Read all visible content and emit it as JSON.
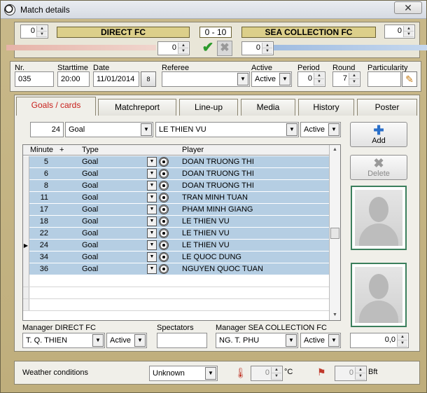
{
  "window": {
    "title": "Match details",
    "close_glyph": "✕"
  },
  "match": {
    "home_team": "DIRECT FC",
    "away_team": "SEA COLLECTION FC",
    "score": "0  - 10",
    "home_left_value": "0",
    "away_right_value": "0",
    "home_sub_value": "0",
    "away_sub_value": "0"
  },
  "details": {
    "nr_label": "Nr.",
    "nr_value": "035",
    "starttime_label": "Starttime",
    "starttime_value": "20:00",
    "date_label": "Date",
    "date_value": "11/01/2014",
    "calendar_glyph": "8",
    "referee_label": "Referee",
    "referee_value": "",
    "active_label": "Active",
    "active_value": "Active",
    "period_label": "Period",
    "period_value": "0",
    "round_label": "Round",
    "round_value": "7",
    "particularity_label": "Particularity",
    "particularity_value": ""
  },
  "tabs": [
    {
      "label": "Goals / cards",
      "active": true
    },
    {
      "label": "Matchreport",
      "active": false
    },
    {
      "label": "Line-up",
      "active": false
    },
    {
      "label": "Media",
      "active": false
    },
    {
      "label": "History",
      "active": false
    },
    {
      "label": "Poster",
      "active": false
    }
  ],
  "entry": {
    "minute": "24",
    "type": "Goal",
    "player": "LE THIEN VU",
    "status": "Active"
  },
  "grid": {
    "headers": {
      "minute": "Minute",
      "plus": "+",
      "type": "Type",
      "player": "Player"
    },
    "rows": [
      {
        "minute": "5",
        "type": "Goal",
        "player": "DOAN TRUONG THI",
        "current": false
      },
      {
        "minute": "6",
        "type": "Goal",
        "player": "DOAN TRUONG THI",
        "current": false
      },
      {
        "minute": "8",
        "type": "Goal",
        "player": "DOAN TRUONG THI",
        "current": false
      },
      {
        "minute": "11",
        "type": "Goal",
        "player": "TRAN MINH TUAN",
        "current": false
      },
      {
        "minute": "17",
        "type": "Goal",
        "player": "PHAM MINH GIANG",
        "current": false
      },
      {
        "minute": "18",
        "type": "Goal",
        "player": "LE THIEN VU",
        "current": false
      },
      {
        "minute": "22",
        "type": "Goal",
        "player": "LE THIEN VU",
        "current": false
      },
      {
        "minute": "24",
        "type": "Goal",
        "player": "LE THIEN VU",
        "current": true
      },
      {
        "minute": "34",
        "type": "Goal",
        "player": "LE QUOC DUNG",
        "current": false
      },
      {
        "minute": "36",
        "type": "Goal",
        "player": "NGUYEN QUOC TUAN",
        "current": false
      }
    ]
  },
  "actions": {
    "add_label": "Add",
    "delete_label": "Delete"
  },
  "managers": {
    "home_label": "Manager DIRECT FC",
    "home_value": "T. Q. THIEN",
    "home_status": "Active",
    "spectators_label": "Spectators",
    "spectators_value": "",
    "away_label": "Manager SEA COLLECTION FC",
    "away_value": "NG. T. PHU",
    "away_status": "Active",
    "rating_value": "0,0"
  },
  "weather": {
    "label": "Weather conditions",
    "value": "Unknown",
    "temp_value": "0",
    "temp_unit": "°C",
    "wind_value": "0",
    "wind_unit": "Bft"
  },
  "colors": {
    "accent_tab": "#c8201c",
    "row_fill": "#b5cee3",
    "team_box": "#dccf8a",
    "ok": "#2c9a2c"
  }
}
